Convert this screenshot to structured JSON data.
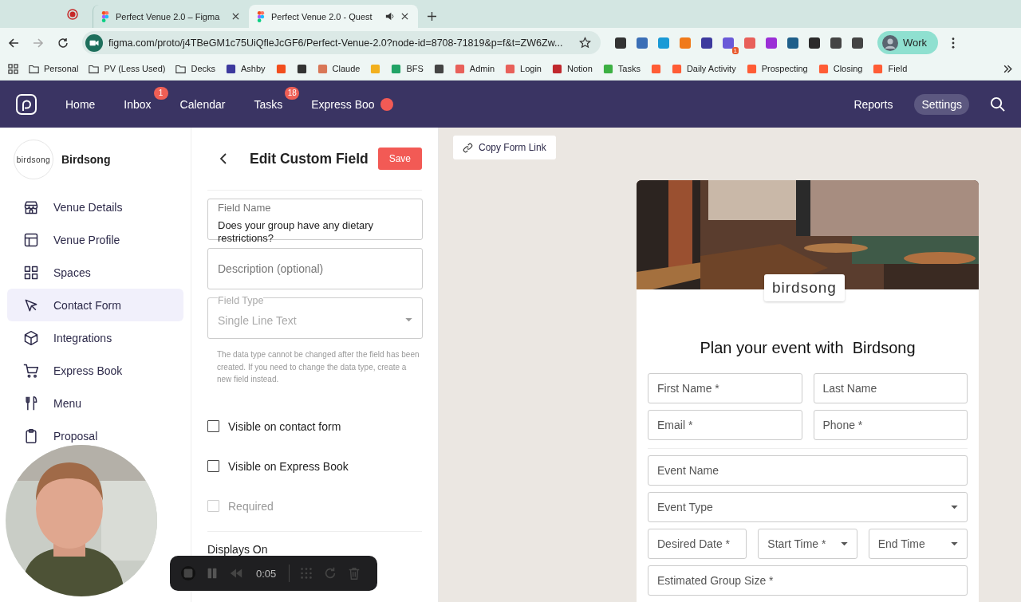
{
  "browser": {
    "tabs": [
      {
        "title": "Perfect Venue 2.0 – Figma",
        "selected": false,
        "audio": false
      },
      {
        "title": "Perfect Venue 2.0 - Quest",
        "selected": true,
        "audio": true
      }
    ],
    "url": "figma.com/proto/j4TBeGM1c75UiQfleJcGF6/Perfect-Venue-2.0?node-id=8708-71819&p=f&t=ZW6Zw...",
    "extension_badge": "1",
    "profile": "Work",
    "bookmarks": [
      {
        "kind": "folder",
        "label": "Personal"
      },
      {
        "kind": "folder",
        "label": "PV (Less Used)"
      },
      {
        "kind": "folder",
        "label": "Decks"
      },
      {
        "kind": "site",
        "label": "Ashby",
        "color": "#3d3a9e"
      },
      {
        "kind": "site",
        "color": "#f24e1e"
      },
      {
        "kind": "site",
        "color": "#333333"
      },
      {
        "kind": "site",
        "label": "Claude",
        "color": "#d97757"
      },
      {
        "kind": "site",
        "color": "#f2b01e"
      },
      {
        "kind": "site",
        "label": "BFS",
        "color": "#21a366"
      },
      {
        "kind": "site",
        "color": "#444444"
      },
      {
        "kind": "site",
        "label": "Admin",
        "color": "#e8605a"
      },
      {
        "kind": "site",
        "label": "Login",
        "color": "#e8605a"
      },
      {
        "kind": "site",
        "label": "Notion",
        "color": "#c0282d"
      },
      {
        "kind": "site",
        "label": "Tasks",
        "color": "#3cb043"
      },
      {
        "kind": "site",
        "color": "#ff5c35"
      },
      {
        "kind": "site",
        "label": "Daily Activity",
        "color": "#ff5c35"
      },
      {
        "kind": "site",
        "label": "Prospecting",
        "color": "#ff5c35"
      },
      {
        "kind": "site",
        "label": "Closing",
        "color": "#ff5c35"
      },
      {
        "kind": "site",
        "label": "Field",
        "color": "#ff5c35"
      }
    ]
  },
  "nav": {
    "items": [
      {
        "label": "Home",
        "selected": false
      },
      {
        "label": "Inbox",
        "badge": "1",
        "selected": false
      },
      {
        "label": "Calendar",
        "selected": false
      },
      {
        "label": "Tasks",
        "badge": "18",
        "selected": false
      },
      {
        "label": "Express Boo",
        "selected": false
      }
    ],
    "right": [
      {
        "label": "Reports",
        "selected": false
      },
      {
        "label": "Settings",
        "selected": true
      }
    ]
  },
  "sidebar": {
    "logo": "birdsong",
    "venue": "Birdsong",
    "items": [
      {
        "label": "Venue Details",
        "selected": false
      },
      {
        "label": "Venue Profile",
        "selected": false
      },
      {
        "label": "Spaces",
        "selected": false
      },
      {
        "label": "Contact Form",
        "selected": true
      },
      {
        "label": "Integrations",
        "selected": false
      },
      {
        "label": "Express Book",
        "selected": false
      },
      {
        "label": "Menu",
        "selected": false
      },
      {
        "label": "Proposal",
        "selected": false
      }
    ]
  },
  "editor": {
    "title": "Edit Custom Field",
    "save": "Save",
    "field_name": {
      "label": "Field Name",
      "value": "Does your group have any dietary restrictions?"
    },
    "description": {
      "placeholder": "Description (optional)"
    },
    "field_type": {
      "label": "Field Type",
      "value": "Single Line Text",
      "disabled": true
    },
    "help": "The data type cannot be changed after the field has been created. If you need to change the data type, create a new field instead.",
    "checkboxes": [
      {
        "label": "Visible on contact form",
        "checked": false,
        "disabled": false
      },
      {
        "label": "Visible on Express Book",
        "checked": false,
        "disabled": false
      },
      {
        "label": "Required",
        "checked": false,
        "disabled": true
      }
    ],
    "section": "Displays On"
  },
  "preview": {
    "copy_link": "Copy Form Link",
    "logo": "birdsong",
    "heading": "Plan your event with  Birdsong",
    "rows": [
      [
        {
          "kind": "text",
          "placeholder": "First Name *"
        },
        {
          "kind": "text",
          "placeholder": "Last Name"
        }
      ],
      [
        {
          "kind": "text",
          "placeholder": "Email *"
        },
        {
          "kind": "text",
          "placeholder": "Phone *"
        }
      ],
      [
        {
          "kind": "text",
          "placeholder": "Event Name"
        }
      ],
      [
        {
          "kind": "select",
          "placeholder": "Event Type"
        }
      ],
      [
        {
          "kind": "text",
          "placeholder": "Desired Date *"
        },
        {
          "kind": "select",
          "placeholder": "Start Time *"
        },
        {
          "kind": "select",
          "placeholder": "End Time"
        }
      ],
      [
        {
          "kind": "text",
          "placeholder": "Estimated Group Size *"
        }
      ]
    ]
  },
  "recorder": {
    "time": "0:05"
  }
}
